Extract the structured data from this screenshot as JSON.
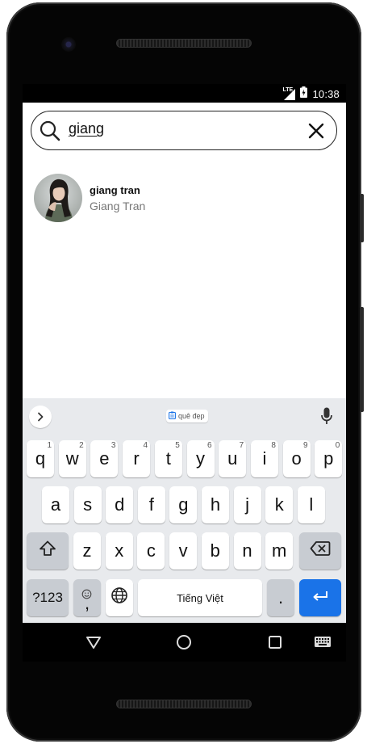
{
  "status_bar": {
    "time": "10:38",
    "network": "LTE"
  },
  "search": {
    "query": "giang"
  },
  "results": [
    {
      "username": "giang tran",
      "display_name": "Giang Tran"
    }
  ],
  "keyboard": {
    "suggestion_chip": "quê đẹp",
    "row1": [
      {
        "label": "q",
        "hint": "1"
      },
      {
        "label": "w",
        "hint": "2"
      },
      {
        "label": "e",
        "hint": "3"
      },
      {
        "label": "r",
        "hint": "4"
      },
      {
        "label": "t",
        "hint": "5"
      },
      {
        "label": "y",
        "hint": "6"
      },
      {
        "label": "u",
        "hint": "7"
      },
      {
        "label": "i",
        "hint": "8"
      },
      {
        "label": "o",
        "hint": "9"
      },
      {
        "label": "p",
        "hint": "0"
      }
    ],
    "row2": [
      "a",
      "s",
      "d",
      "f",
      "g",
      "h",
      "j",
      "k",
      "l"
    ],
    "row3": [
      "z",
      "x",
      "c",
      "v",
      "b",
      "n",
      "m"
    ],
    "symbols_label": "?123",
    "comma_label": ",",
    "space_label": "Tiếng Việt",
    "period_label": ".",
    "colors": {
      "background": "#e8eaed",
      "key": "#ffffff",
      "function_key": "#c8ccd2",
      "enter": "#1a73e8"
    }
  },
  "icons": {
    "search": "search-icon",
    "clear": "close-icon",
    "expand": "chevron-right-icon",
    "clipboard": "clipboard-icon",
    "mic": "mic-icon",
    "shift": "shift-icon",
    "backspace": "backspace-icon",
    "emoji": "emoji-icon",
    "globe": "globe-icon",
    "enter": "enter-icon",
    "back": "back-triangle-icon",
    "home": "home-circle-icon",
    "recents": "recents-square-icon",
    "keyboard_switch": "keyboard-icon"
  }
}
